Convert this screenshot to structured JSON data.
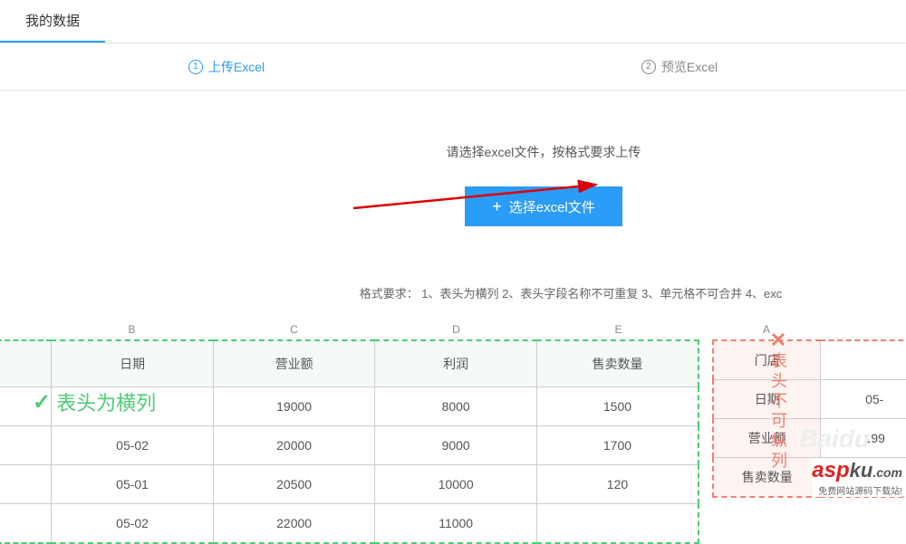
{
  "topTab": "我的数据",
  "steps": {
    "step1": {
      "num": "1",
      "label": "上传Excel"
    },
    "step2": {
      "num": "2",
      "label": "预览Excel"
    }
  },
  "upload": {
    "hint": "请选择excel文件，按格式要求上传",
    "buttonLabel": "选择excel文件"
  },
  "formatReq": "格式要求： 1、表头为横列   2、表头字段名称不可重复   3、单元格不可合并   4、exc",
  "goodTable": {
    "colLetters": [
      "B",
      "C",
      "D",
      "E"
    ],
    "headers": [
      "日期",
      "营业额",
      "利润",
      "售卖数量"
    ],
    "rows": [
      [
        "",
        "19000",
        "8000",
        "1500"
      ],
      [
        "05-02",
        "20000",
        "9000",
        "1700"
      ],
      [
        "05-01",
        "20500",
        "10000",
        "120"
      ],
      [
        "05-02",
        "22000",
        "11000",
        ""
      ]
    ],
    "label": "表头为横列"
  },
  "badTable": {
    "colLetters": [
      "A",
      ""
    ],
    "rows": [
      [
        "门店",
        ""
      ],
      [
        "日期",
        "05-"
      ],
      [
        "营业额",
        "199"
      ],
      [
        "售卖数量",
        ""
      ]
    ],
    "label": "表头不可纵列"
  },
  "watermark": "Baidu",
  "brand": {
    "red": "asp",
    "thin": "ku",
    "dot": ".com",
    "sub": "免费网站源码下载站!"
  }
}
